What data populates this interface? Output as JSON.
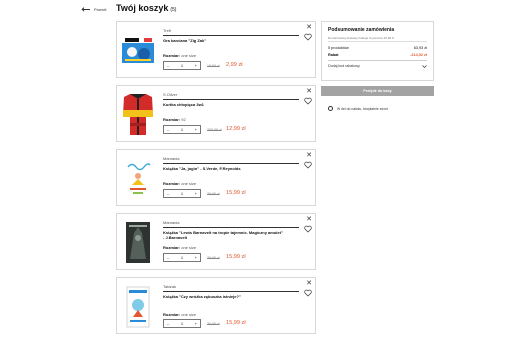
{
  "header": {
    "back_label": "Powrót",
    "title": "Twój koszyk",
    "count": "(5)"
  },
  "accent_color": "#e2572e",
  "items": [
    {
      "brand": "Trefl",
      "name": "Gra karciana \"Zig Zak\"",
      "size_label": "Rozmiar:",
      "size": "one size",
      "qty": "1",
      "old_price": "19,99 zł",
      "price": "2,99 zł",
      "minus": "–",
      "plus": "+",
      "close": "✕",
      "image": "board-game-box"
    },
    {
      "brand": "S.Oliver",
      "name": "Kurtka chłopięca 3w1",
      "size_label": "Rozmiar:",
      "size": "92",
      "qty": "1",
      "old_price": "359,99 zł",
      "price": "12,99 zł",
      "minus": "–",
      "plus": "+",
      "close": "✕",
      "image": "red-jacket"
    },
    {
      "brand": "Mamania",
      "name": "Książka \"Ja, jogin\" - S.Verde, F.Reynolds",
      "size_label": "Rozmiar:",
      "size": "one size",
      "qty": "1",
      "old_price": "39,99 zł",
      "price": "15,99 zł",
      "minus": "–",
      "plus": "+",
      "close": "✕",
      "image": "book-cover-yoga"
    },
    {
      "brand": "Mamania",
      "name": "Książka \"Lewis Barnavelt na tropie tajemnic. Magiczny amulet\" - J.Barnavelt",
      "size_label": "Rozmiar:",
      "size": "one size",
      "qty": "1",
      "old_price": "39,99 zł",
      "price": "15,99 zł",
      "minus": "–",
      "plus": "+",
      "close": "✕",
      "image": "book-cover-dark"
    },
    {
      "brand": "Tatarak",
      "name": "Książka \"Czy wróżka zębuszka istnieje?\"",
      "size_label": "Rozmiar:",
      "size": "one size",
      "qty": "1",
      "old_price": "39,99 zł",
      "price": "15,99 zł",
      "minus": "–",
      "plus": "+",
      "close": "✕",
      "image": "book-cover-fairy"
    }
  ],
  "summary": {
    "title": "Podsumowanie zamówienia",
    "shipping_note": "Do darmowej dostawy brakuje Ci jeszcze 46,99 zł",
    "shipping_progress_fraction": 0,
    "products_label": "5 produktów",
    "products_value": "63,93 zł",
    "discount_label": "Rabat",
    "discount_value": "-214,02 zł",
    "code_label": "Dodaj kod rabatowy",
    "checkout_label": "Przejdź do kasy",
    "gift_label": "W del do nałożu, bezpłatnie zwrot"
  }
}
